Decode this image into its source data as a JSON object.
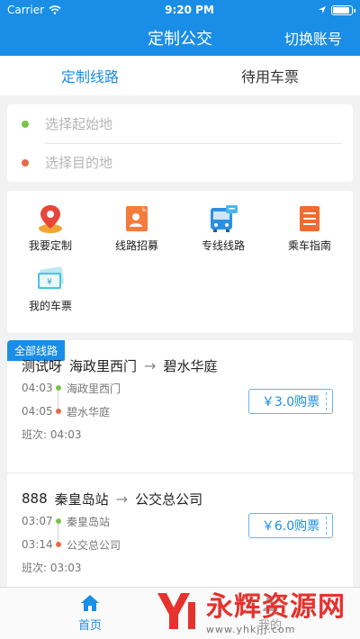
{
  "status_bar": {
    "carrier": "Carrier",
    "time": "9:20 PM"
  },
  "nav": {
    "title": "定制公交",
    "switch_account": "切换账号"
  },
  "tabs": [
    {
      "label": "定制线路",
      "active": true
    },
    {
      "label": "待用车票",
      "active": false
    }
  ],
  "address": {
    "start_placeholder": "选择起始地",
    "end_placeholder": "选择目的地"
  },
  "menu": [
    {
      "label": "我要定制",
      "icon": "location-pin-icon"
    },
    {
      "label": "线路招募",
      "icon": "recruit-icon"
    },
    {
      "label": "专线线路",
      "icon": "bus-icon"
    },
    {
      "label": "乘车指南",
      "icon": "guide-icon"
    },
    {
      "label": "我的车票",
      "icon": "ticket-icon"
    }
  ],
  "routes_section": {
    "tag": "全部线路"
  },
  "routes": [
    {
      "name": "测试呀",
      "from": "海政里西门",
      "to": "碧水华庭",
      "arrow": "→",
      "stops": [
        {
          "time": "04:03",
          "name": "海政里西门"
        },
        {
          "time": "04:05",
          "name": "碧水华庭"
        }
      ],
      "shift_label": "班次:",
      "shift_time": "04:03",
      "price": "￥3.0购票"
    },
    {
      "name": "888",
      "from": "秦皇岛站",
      "to": "公交总公司",
      "arrow": "→",
      "stops": [
        {
          "time": "03:07",
          "name": "秦皇岛站"
        },
        {
          "time": "03:14",
          "name": "公交总公司"
        }
      ],
      "shift_label": "班次:",
      "shift_time": "03:03",
      "price": "￥6.0购票"
    }
  ],
  "tabbar": [
    {
      "label": "首页",
      "icon": "home-icon",
      "active": true
    },
    {
      "label": "我的",
      "icon": "user-icon",
      "active": false
    }
  ],
  "watermark": {
    "main": "永辉资源网",
    "sub": "www.yhkjjj.com"
  },
  "colors": {
    "primary": "#1a8ee6",
    "green_dot": "#7cc448",
    "red_dot": "#e8694a",
    "watermark_red": "#e5322d"
  }
}
